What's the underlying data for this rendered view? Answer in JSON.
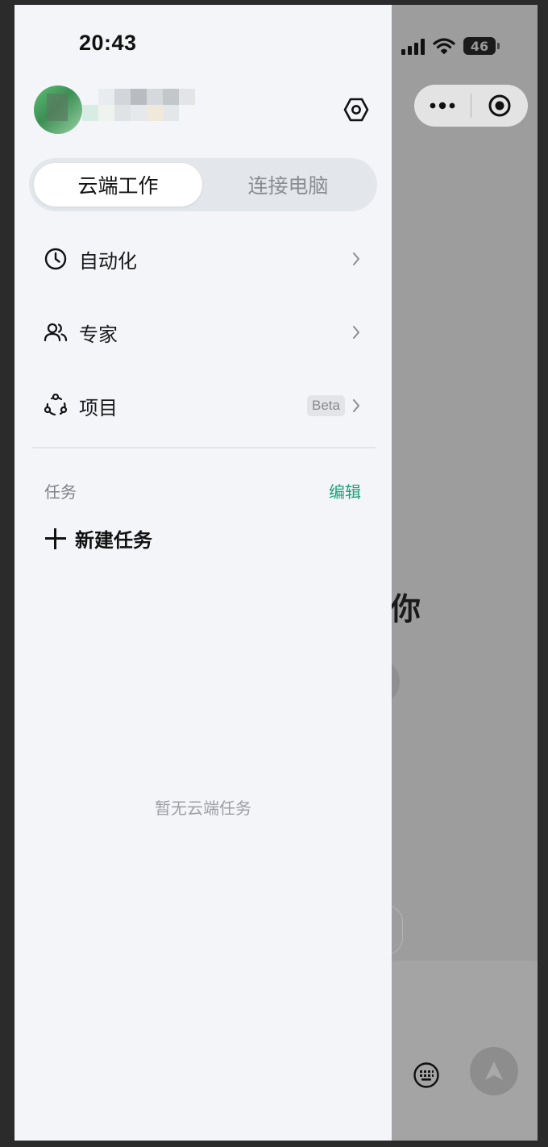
{
  "status_bar": {
    "time": "20:43",
    "battery": "46"
  },
  "drawer": {
    "user": {
      "name_obscured": true
    },
    "segments": [
      {
        "label": "云端工作",
        "active": true
      },
      {
        "label": "连接电脑",
        "active": false
      }
    ],
    "menu": [
      {
        "label": "自动化",
        "icon": "clock-icon"
      },
      {
        "label": "专家",
        "icon": "people-icon"
      },
      {
        "label": "项目",
        "icon": "project-icon",
        "badge": "Beta"
      }
    ],
    "tasks": {
      "title": "任务",
      "edit_label": "编辑",
      "new_task_label": "新建任务",
      "empty_text": "暂无云端任务"
    }
  },
  "background_app": {
    "greeting_partial": "你"
  },
  "colors": {
    "accent": "#1aa37a",
    "drawer_bg": "#f3f5f9",
    "overlay": "#9d9d9d"
  }
}
